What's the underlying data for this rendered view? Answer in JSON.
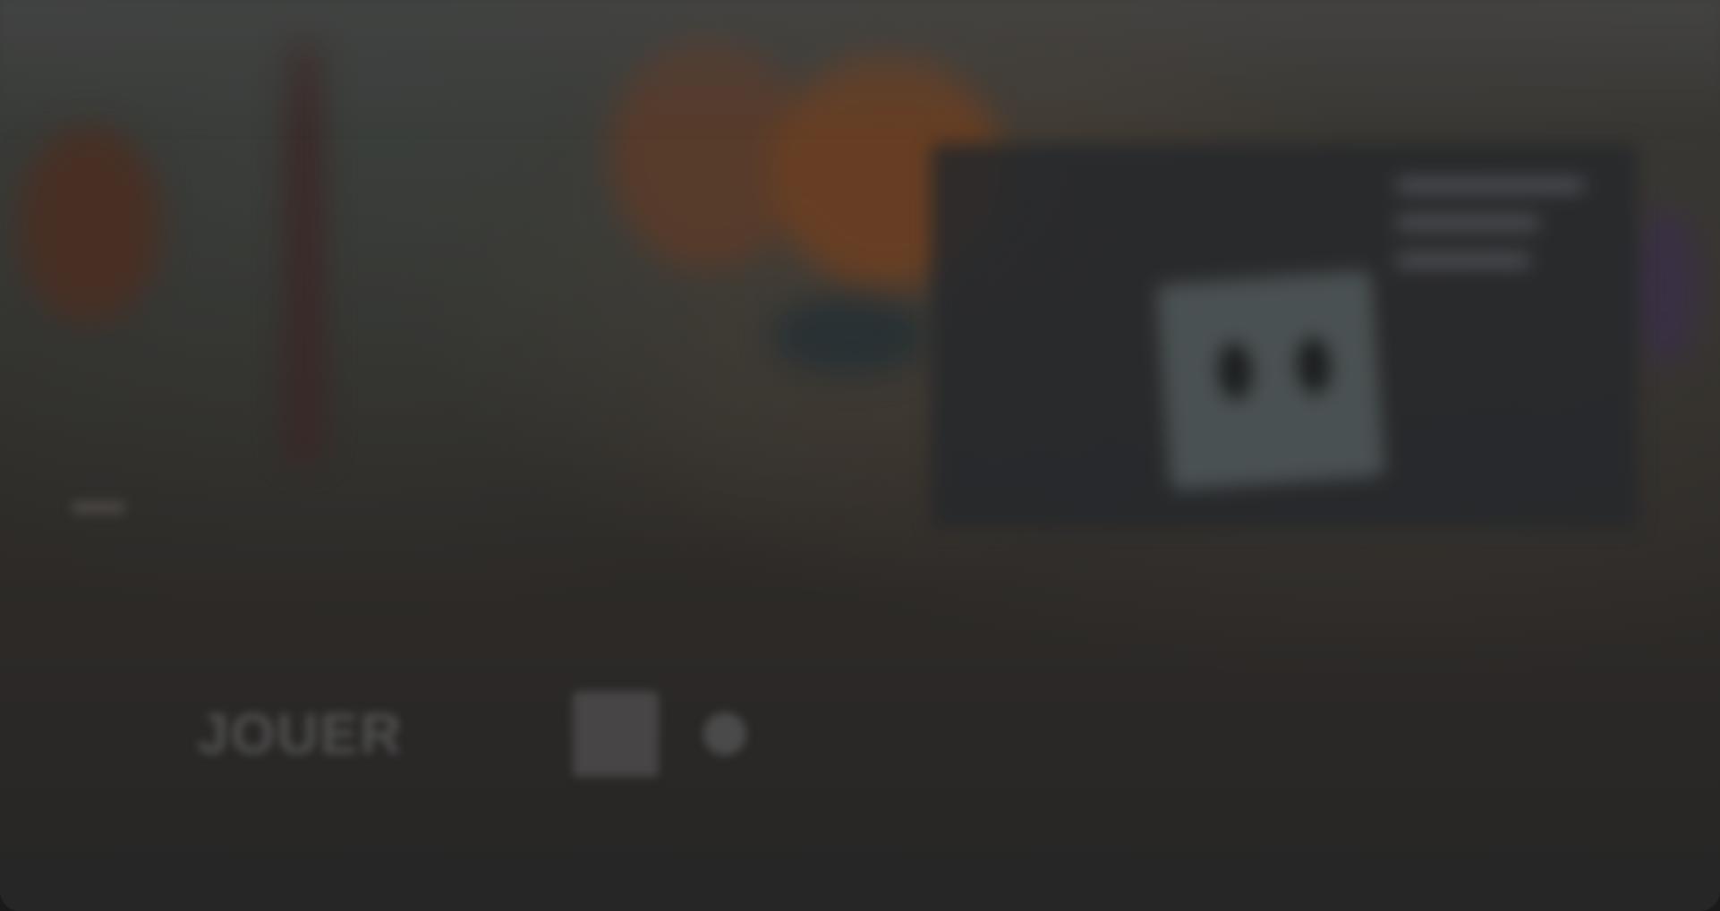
{
  "nav": {
    "links": [
      "",
      "",
      "",
      ""
    ]
  },
  "news": {
    "title": "",
    "subtitle": ""
  },
  "play": {
    "label": "JOUER"
  },
  "footer": {
    "text": ""
  },
  "icons": {
    "settings": "gear-icon",
    "version": "version-select-icon"
  },
  "colors": {
    "accent": "#3d6f67",
    "background": "#2c2927"
  }
}
